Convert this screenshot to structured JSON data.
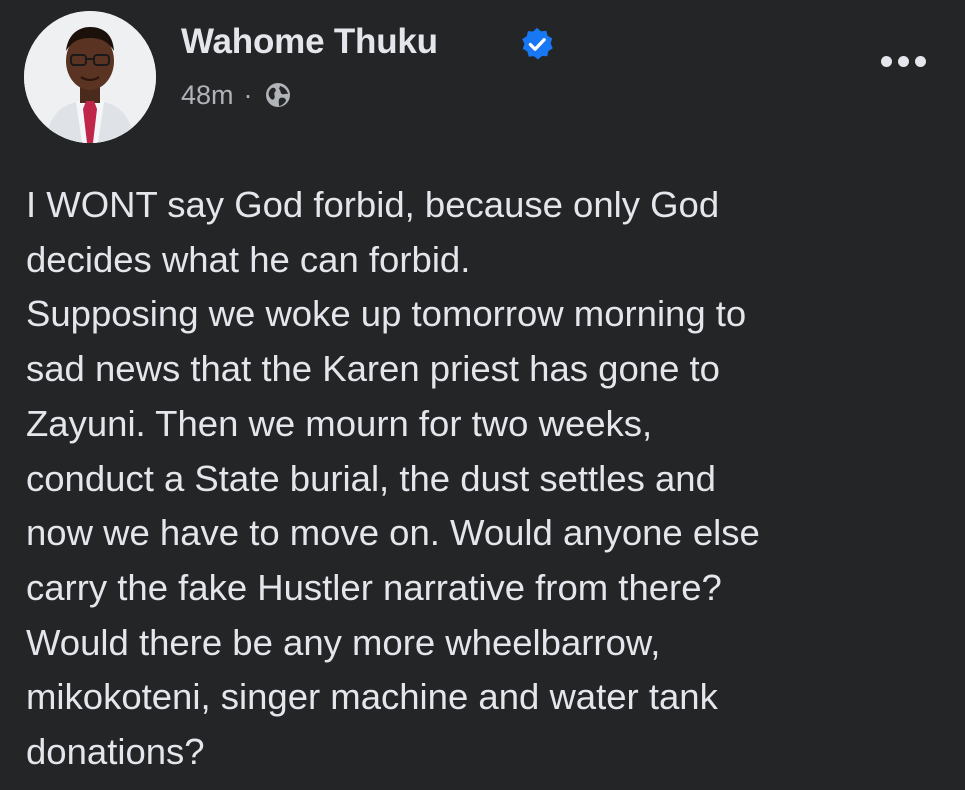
{
  "post": {
    "author_name": "Wahome Thuku",
    "timestamp": "48m",
    "separator": "·",
    "verified": true,
    "privacy_icon": "globe-icon",
    "more_icon": "more-options-icon",
    "lines": [
      "I WONT say God forbid, because only God",
      "decides what he can forbid.",
      "Supposing we woke up tomorrow morning to",
      "sad news that the Karen priest has gone to",
      "Zayuni. Then we mourn for two weeks,",
      "conduct a State burial, the dust settles and",
      "now we have to move on. Would anyone else",
      "carry the fake Hustler narrative from there?",
      "Would there be any more wheelbarrow,",
      "mikokoteni, singer machine and water tank",
      "donations?"
    ]
  },
  "colors": {
    "background": "#242526",
    "primary_text": "#e4e6eb",
    "secondary_text": "#b0b3b8",
    "verified_badge": "#1877f2"
  }
}
